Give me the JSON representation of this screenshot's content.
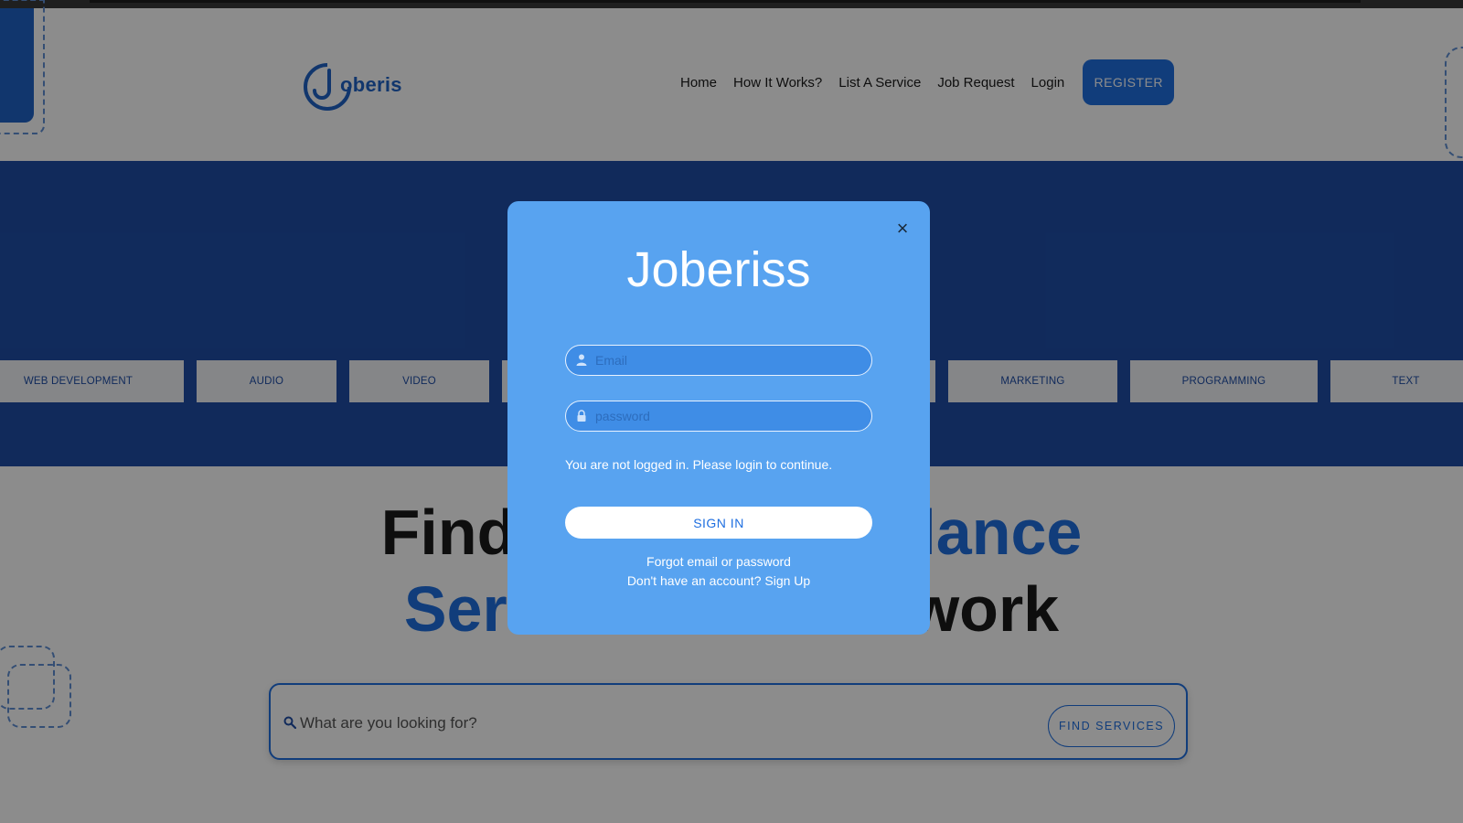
{
  "header": {
    "logo_text": "oberis",
    "nav": [
      "Home",
      "How It Works?",
      "List A Service",
      "Job Request",
      "Login"
    ],
    "register_label": "REGISTER"
  },
  "categories": [
    "WEB DEVELOPMENT",
    "AUDIO",
    "VIDEO",
    "",
    "",
    "MARKETING",
    "PROGRAMMING",
    "TEXT"
  ],
  "headline": {
    "line1_dark": "Find",
    "line1_blue": "lance",
    "line2_blue": "Ser",
    "line2_dark": "work"
  },
  "search": {
    "placeholder": "What are you looking for?",
    "button_label": "FIND SERVICES"
  },
  "modal": {
    "title": "Joberiss",
    "close_label": "×",
    "email_placeholder": "Email",
    "password_placeholder": "password",
    "notice": "You are not logged in. Please login to continue.",
    "signin_label": "SIGN IN",
    "forgot_label": "Forgot email or password",
    "signup_prompt": "Don't have an account? Sign Up"
  },
  "colors": {
    "brand": "#1f6fe0",
    "hero_band": "#1f4ea7",
    "modal_bg": "#58a3f0"
  }
}
